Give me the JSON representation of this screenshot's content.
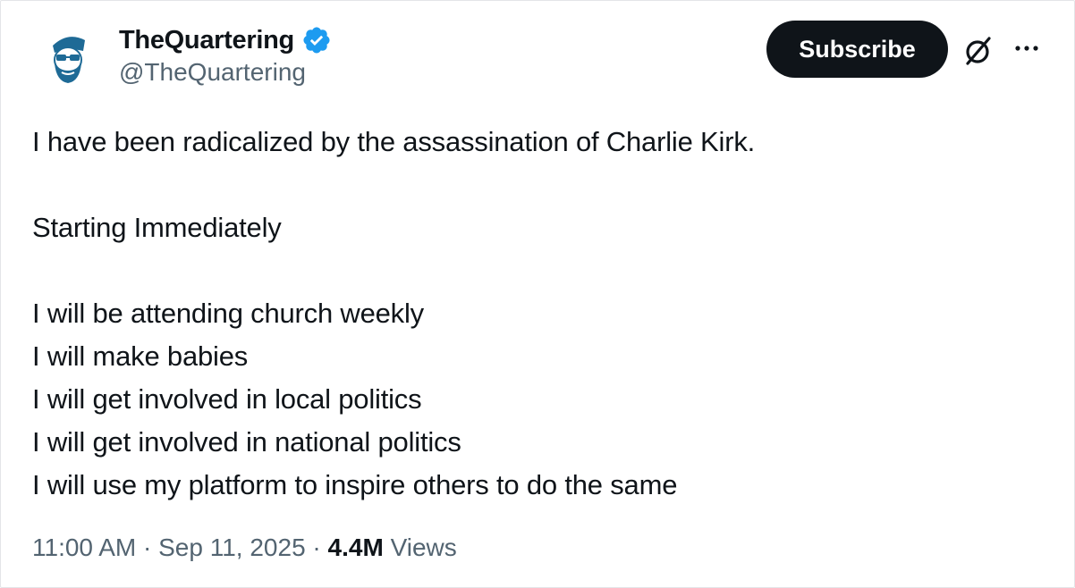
{
  "author": {
    "display_name": "TheQuartering",
    "handle": "@TheQuartering",
    "verified": true,
    "verified_color": "#1d9bf0"
  },
  "actions": {
    "subscribe_label": "Subscribe",
    "grok_icon": "grok-icon",
    "more_icon": "more-icon"
  },
  "tweet": {
    "lines": [
      "I have been radicalized by the assassination of Charlie Kirk.",
      "",
      "Starting Immediately",
      "",
      "I will be attending church weekly",
      "I will make babies",
      "I will get involved in local politics",
      "I will get involved in national politics",
      "I will use my platform to inspire others to do the same"
    ]
  },
  "meta": {
    "time": "11:00 AM",
    "separator": "·",
    "date": "Sep 11, 2025",
    "views_count": "4.4M",
    "views_label": "Views"
  },
  "colors": {
    "text": "#0f1419",
    "secondary": "#536471",
    "button_bg": "#0f1419",
    "avatar_hair": "#1e6a96"
  }
}
